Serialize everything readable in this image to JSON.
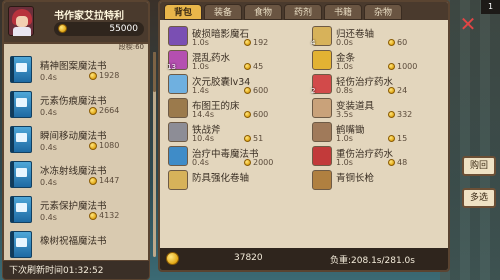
{
  "merchant": {
    "name": "书作家艾拉特利",
    "gold": "55000",
    "level": "段楔:60"
  },
  "left_items": [
    {
      "name": "精神图案魔法书",
      "time": "0.4s",
      "price": "1928",
      "icon": "blue-book-icon"
    },
    {
      "name": "元素伤痕魔法书",
      "time": "0.4s",
      "price": "2664",
      "icon": "blue-book-icon"
    },
    {
      "name": "瞬间移动魔法书",
      "time": "0.4s",
      "price": "1080",
      "icon": "blue-book-icon"
    },
    {
      "name": "冰冻射线魔法书",
      "time": "0.4s",
      "price": "1447",
      "icon": "blue-book-icon"
    },
    {
      "name": "元素保护魔法书",
      "time": "0.4s",
      "price": "4132",
      "icon": "blue-book-icon"
    },
    {
      "name": "橡树祝福魔法书",
      "time": "",
      "price": "",
      "icon": "blue-book-icon"
    }
  ],
  "refresh": "下次刷新时间01:32:52",
  "tabs": [
    {
      "label": "背包",
      "active": true
    },
    {
      "label": "装备",
      "active": false
    },
    {
      "label": "食物",
      "active": false
    },
    {
      "label": "药剂",
      "active": false
    },
    {
      "label": "书籍",
      "active": false
    },
    {
      "label": "杂物",
      "active": false
    }
  ],
  "inventory": [
    {
      "name": "破损暗影魔石",
      "time": "1.0s",
      "price": "192",
      "qty": "",
      "color": "#7a4fb3",
      "icon": "purple-crystal-icon"
    },
    {
      "name": "归还卷轴",
      "time": "0.0s",
      "price": "60",
      "qty": "4",
      "color": "#d7b25a",
      "icon": "scroll-icon"
    },
    {
      "name": "混乱药水",
      "time": "1.0s",
      "price": "45",
      "qty": "13",
      "color": "#b44fb0",
      "icon": "potion-flask-icon"
    },
    {
      "name": "金条",
      "time": "1.0s",
      "price": "1000",
      "qty": "",
      "color": "#e2b233",
      "icon": "gold-bar-icon"
    },
    {
      "name": "次元胶囊lv34",
      "time": "1.4s",
      "price": "600",
      "qty": "",
      "color": "#6fb0e0",
      "icon": "capsule-icon"
    },
    {
      "name": "轻伤治疗药水",
      "time": "0.8s",
      "price": "24",
      "qty": "2",
      "color": "#d24a4a",
      "icon": "red-potion-icon"
    },
    {
      "name": "布图王的床",
      "time": "14.4s",
      "price": "600",
      "qty": "",
      "color": "#9b7a4c",
      "icon": "bed-icon"
    },
    {
      "name": "变装道具",
      "time": "3.5s",
      "price": "332",
      "qty": "",
      "color": "#c9a27a",
      "icon": "disguise-icon"
    },
    {
      "name": "铁战斧",
      "time": "10.4s",
      "price": "51",
      "qty": "",
      "color": "#8d8d96",
      "icon": "iron-axe-icon"
    },
    {
      "name": "鹤嘴锄",
      "time": "1.0s",
      "price": "15",
      "qty": "",
      "color": "#a07a5a",
      "icon": "pickaxe-icon"
    },
    {
      "name": "治疗中毒魔法书",
      "time": "0.4s",
      "price": "2000",
      "qty": "",
      "color": "#3f8cc8",
      "icon": "blue-book-icon"
    },
    {
      "name": "重伤治疗药水",
      "time": "1.0s",
      "price": "48",
      "qty": "",
      "color": "#c23a3a",
      "icon": "big-red-potion-icon"
    },
    {
      "name": "防具强化卷轴",
      "time": "",
      "price": "",
      "qty": "",
      "color": "#d7b25a",
      "icon": "scroll-icon"
    },
    {
      "name": "青铜长枪",
      "time": "",
      "price": "",
      "qty": "",
      "color": "#b08040",
      "icon": "spear-icon"
    }
  ],
  "footer": {
    "gold": "37820",
    "load": "负重:208.1s/281.0s"
  },
  "side": {
    "pager": "1",
    "buy_label": "购回",
    "multi_label": "多选",
    "close_glyph": "✕"
  }
}
